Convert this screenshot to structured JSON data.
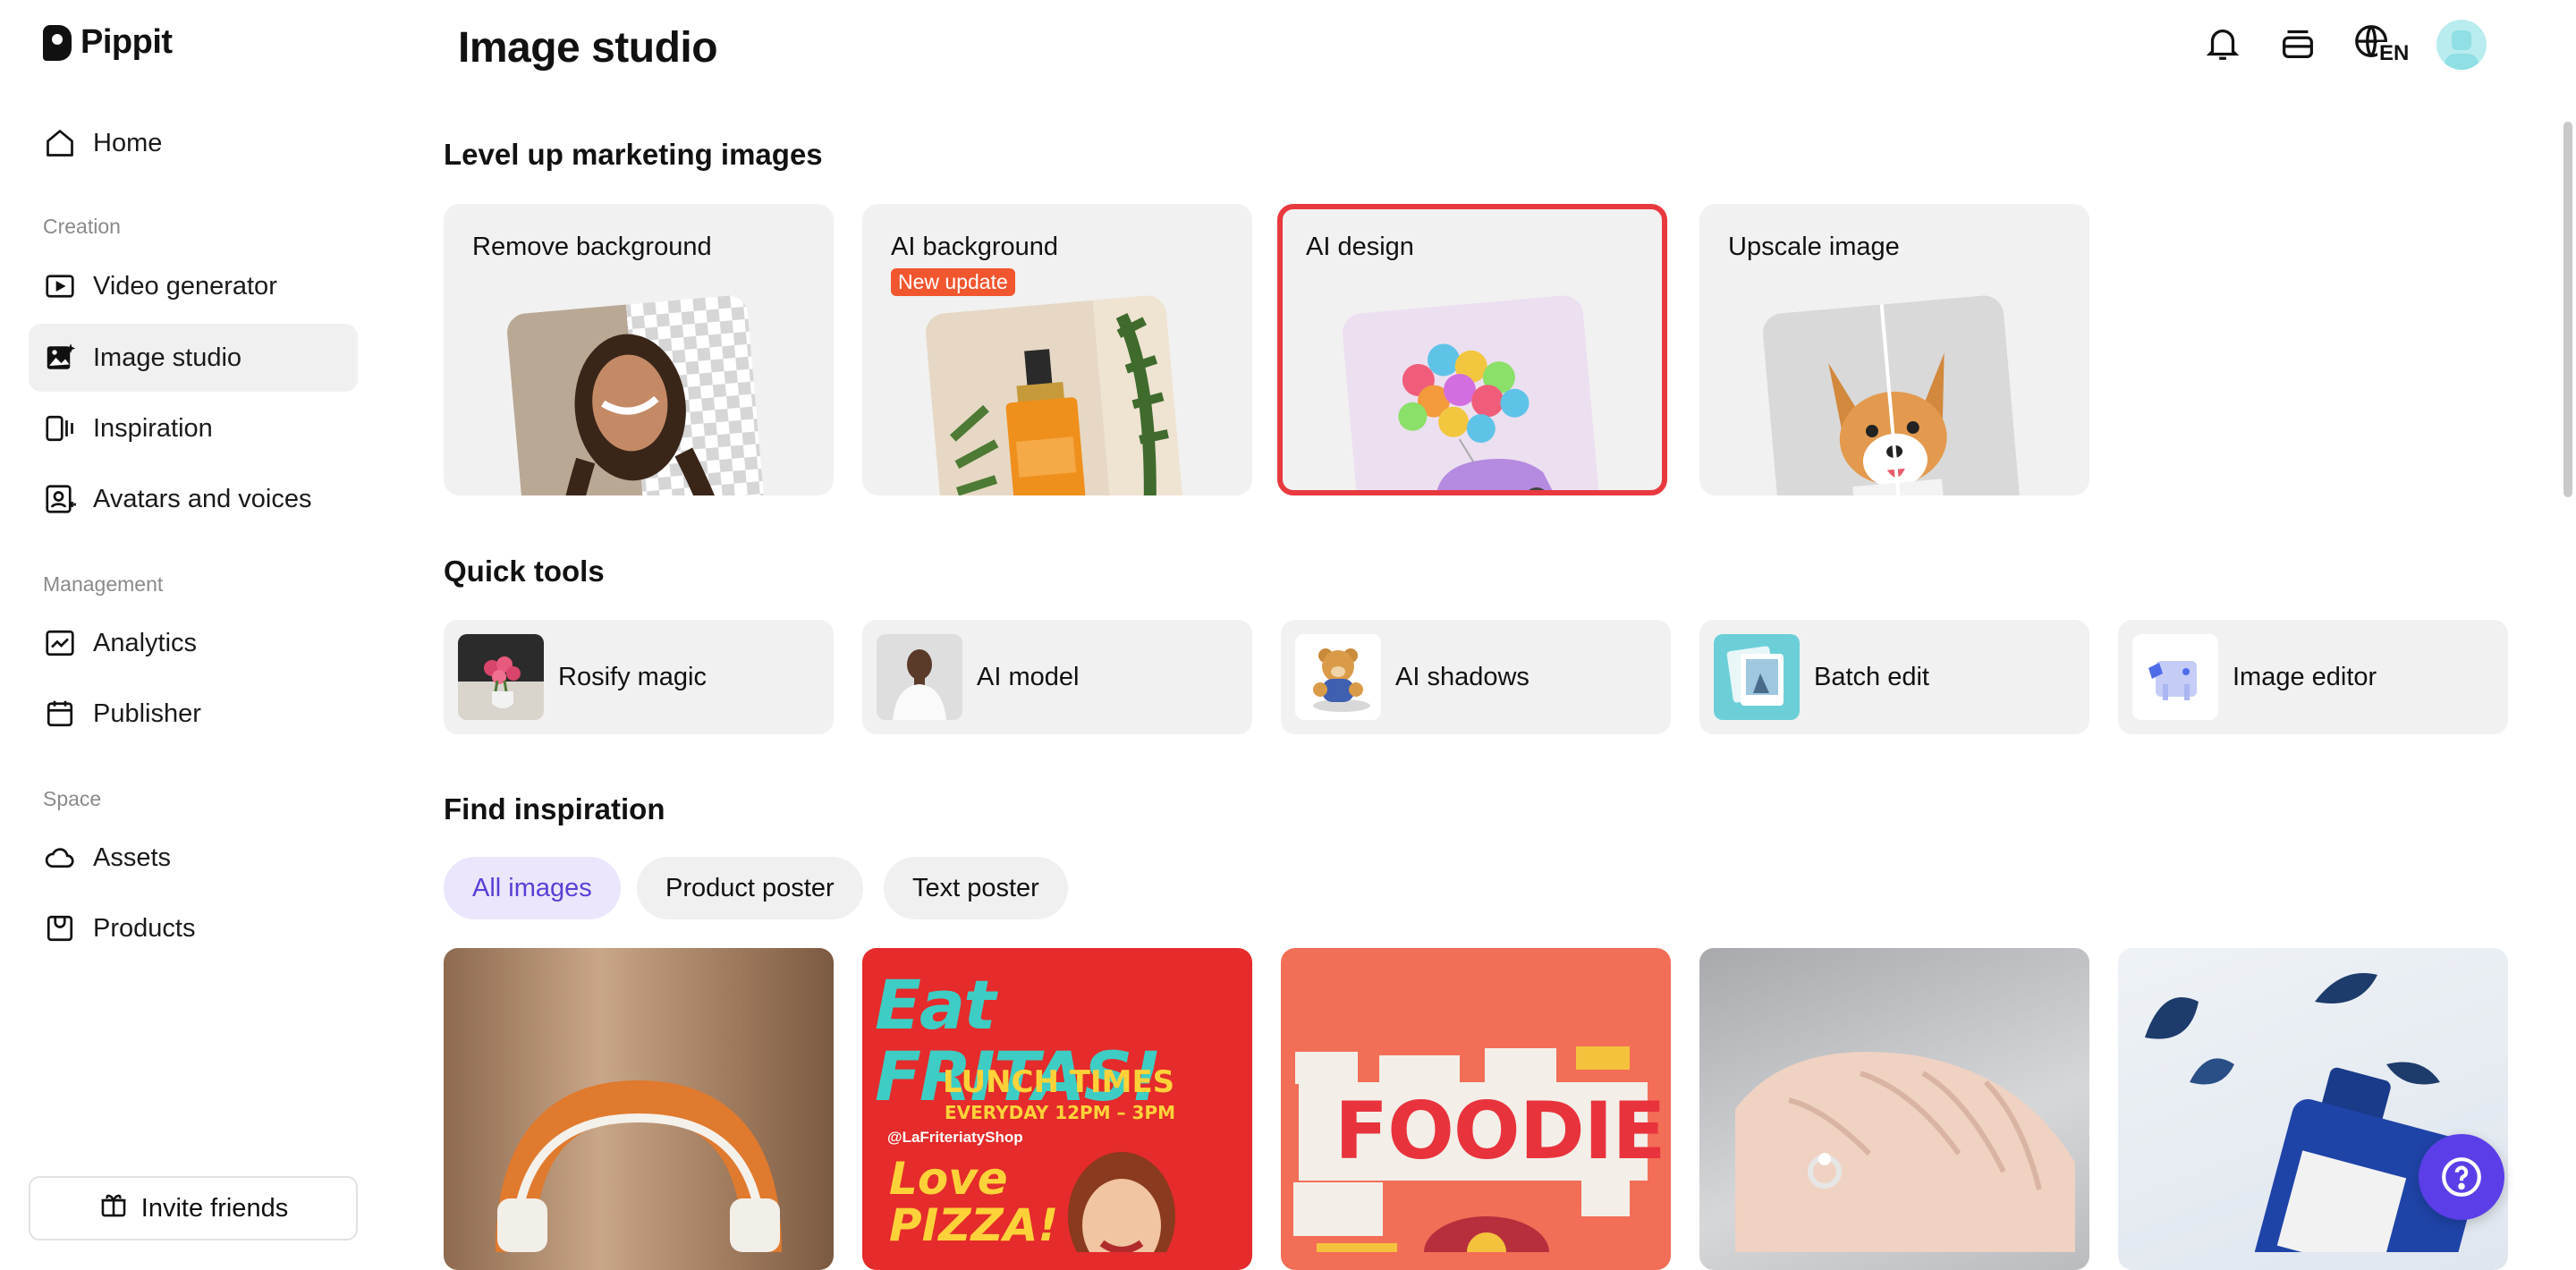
{
  "app": {
    "name": "Pippit"
  },
  "sidebar": {
    "home": "Home",
    "sections": {
      "creation": "Creation",
      "management": "Management",
      "space": "Space"
    },
    "items": [
      {
        "label": "Video generator",
        "icon": "video-play-icon"
      },
      {
        "label": "Image studio",
        "icon": "image-sparkle-icon",
        "active": true
      },
      {
        "label": "Inspiration",
        "icon": "inspiration-icon"
      },
      {
        "label": "Avatars and voices",
        "icon": "avatar-icon"
      },
      {
        "label": "Analytics",
        "icon": "chart-icon"
      },
      {
        "label": "Publisher",
        "icon": "calendar-icon"
      },
      {
        "label": "Assets",
        "icon": "cloud-icon"
      },
      {
        "label": "Products",
        "icon": "box-icon"
      }
    ],
    "invite": "Invite friends"
  },
  "header": {
    "title": "Image studio",
    "language": "EN"
  },
  "level_up": {
    "title": "Level up marketing images",
    "cards": [
      {
        "label": "Remove background"
      },
      {
        "label": "AI background",
        "badge": "New update"
      },
      {
        "label": "AI design",
        "selected": true
      },
      {
        "label": "Upscale image"
      }
    ]
  },
  "quick_tools": {
    "title": "Quick tools",
    "items": [
      {
        "label": "Rosify magic"
      },
      {
        "label": "AI model"
      },
      {
        "label": "AI shadows"
      },
      {
        "label": "Batch edit"
      },
      {
        "label": "Image editor"
      }
    ]
  },
  "inspiration": {
    "title": "Find inspiration",
    "filters": [
      {
        "label": "All images",
        "active": true
      },
      {
        "label": "Product poster"
      },
      {
        "label": "Text poster"
      }
    ],
    "poster_fritas": {
      "headline": "Eat FRITAS!",
      "line1": "LUNCH TIMES",
      "line2": "EVERYDAY 12PM – 3PM",
      "handle": "@LaFriteriatyShop",
      "line3": "Love PIZZA!"
    },
    "poster_foodie": {
      "headline": "FOODIE"
    }
  },
  "colors": {
    "accent": "#5b3ee8",
    "highlight": "#e8393f",
    "badge": "#f2562f"
  }
}
